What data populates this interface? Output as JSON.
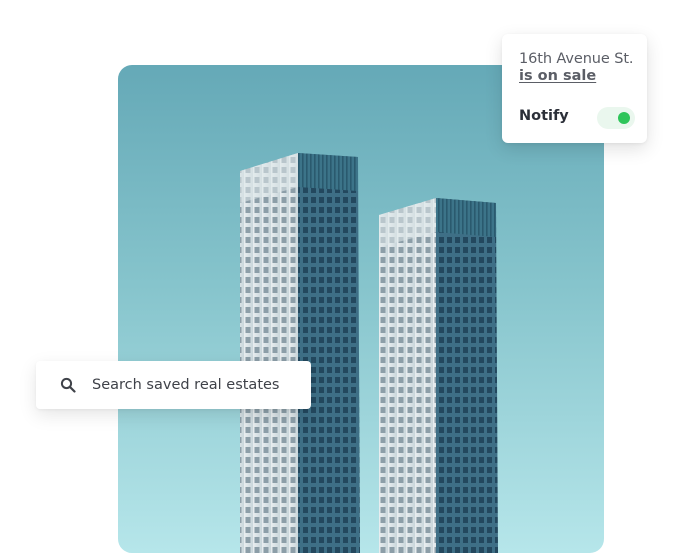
{
  "hero": {
    "image_subject": "twin-towers-photo",
    "sky_colors": [
      "#65a9b7",
      "#b6e6ea"
    ]
  },
  "notification": {
    "address": "16th Avenue St.",
    "status": "is on sale",
    "notify_label": "Notify",
    "notify_enabled": true,
    "toggle_color": "#2ec55a"
  },
  "search": {
    "placeholder": "Search saved real estates",
    "value": "",
    "icon": "search-icon"
  }
}
